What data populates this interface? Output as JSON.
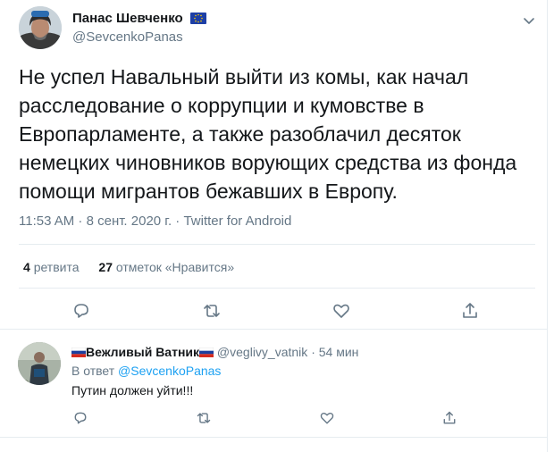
{
  "tweet": {
    "author_name": "Панас Шевченко",
    "author_handle": "@SevcenkoPanas",
    "text_lines": [
      "Не успел Навальный выйти из комы, как начал",
      "расследование о коррупции и кумовстве в",
      "Европарламенте, а также разоблачил десяток",
      "немецких чиновников ворующих средства из фонда",
      "помощи мигрантов бежавших в Европу."
    ],
    "meta": "11:53 AM · 8 сент. 2020 г. · Twitter for Android",
    "retweets_count": "4",
    "retweets_label": "ретвита",
    "likes_count": "27",
    "likes_label": "отметок «Нравится»"
  },
  "reply": {
    "author_name": "Вежливый Ватник",
    "author_handle": "@veglivy_vatnik",
    "time": "· 54 мин",
    "reply_to_prefix": "В ответ",
    "reply_to_handle": "@SevcenkoPanas",
    "text": "Путин должен уйти!!!"
  },
  "icons": {
    "more": "chevron-down-icon",
    "reply": "speech-bubble-icon",
    "retweet": "retweet-arrows-icon",
    "like": "heart-icon",
    "share": "share-upload-icon",
    "eu_flag": "eu-flag-emoji",
    "ru_flag": "russian-flag-emoji"
  },
  "colors": {
    "text": "#14171a",
    "secondary": "#657786",
    "link": "#1da1f2",
    "divider": "#e6ecf0",
    "icon": "#657786"
  }
}
